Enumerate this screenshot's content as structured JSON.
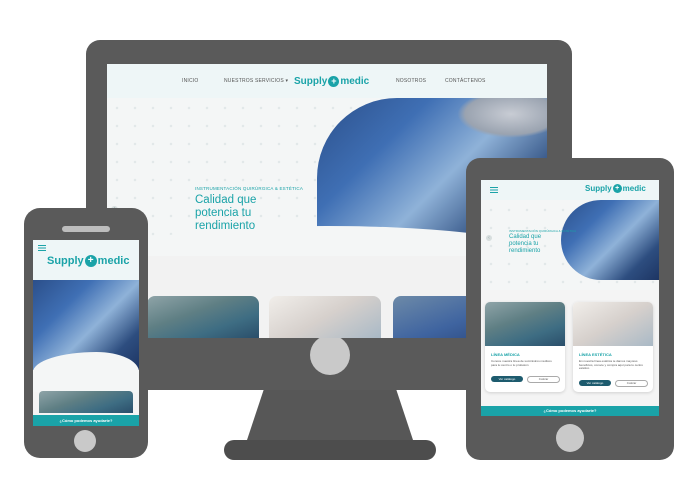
{
  "desktop": {
    "nav": {
      "items": [
        "INICIO",
        "NUESTROS SERVICIOS ▾",
        "NOSOTROS",
        "CONTÁCTENOS"
      ]
    },
    "brand": {
      "left": "Supply",
      "right": "medic"
    },
    "hero": {
      "eyebrow": "INSTRUMENTACIÓN QUIRÚRGICA & ESTÉTICA",
      "title_line1": "Calidad que",
      "title_line2": "potencia tu",
      "title_line3": "rendimiento"
    }
  },
  "tablet": {
    "brand": {
      "left": "Supply",
      "right": "medic"
    },
    "hero": {
      "eyebrow": "INSTRUMENTACIÓN QUIRÚRGICA & ESTÉTICA",
      "title_line1": "Calidad que",
      "title_line2": "potencia tu",
      "title_line3": "rendimiento"
    },
    "cards": [
      {
        "title": "LÍNEA MÉDICA",
        "text": "Conoce nuestra línea de suministros médicos para tu centro o tu profesión",
        "primary": "Ver catálogo",
        "secondary": "Cotizar"
      },
      {
        "title": "LÍNEA ESTÉTICA",
        "text": "En nuestra línea estética te damos mayores beneficios, conoce y compra aquí para tu centro estético",
        "primary": "Ver catálogo",
        "secondary": "Cotizar"
      }
    ],
    "chat": "¿Cómo podemos ayudarte?"
  },
  "phone": {
    "brand": {
      "left": "Supply",
      "right": "medic"
    },
    "chat": "¿Cómo podemos ayudarte?"
  },
  "colors": {
    "accent": "#1aa3a8",
    "device": "#5a5a5a",
    "button_dark": "#1d5b6e"
  }
}
